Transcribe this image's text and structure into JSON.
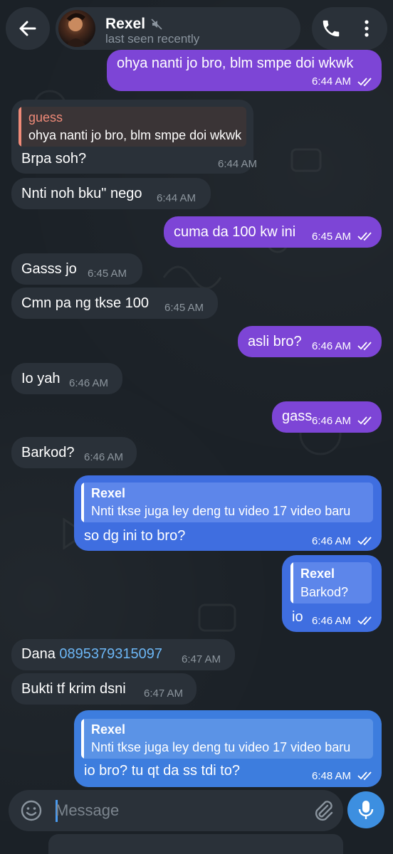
{
  "header": {
    "contact_name": "Rexel",
    "status": "last seen recently"
  },
  "messages": [
    {
      "dir": "out",
      "text": "ohya nanti jo bro, blm smpe doi wkwk",
      "time": "6:44 AM"
    },
    {
      "dir": "in",
      "reply_name": "guess",
      "reply_text": "ohya nanti jo bro, blm smpe doi wkwk",
      "text": "Brpa soh?",
      "time": "6:44 AM"
    },
    {
      "dir": "in",
      "text": "Nnti noh bku\" nego",
      "time": "6:44 AM"
    },
    {
      "dir": "out",
      "text": "cuma da 100 kw ini",
      "time": "6:45 AM"
    },
    {
      "dir": "in",
      "text": "Gasss jo",
      "time": "6:45 AM"
    },
    {
      "dir": "in",
      "text": "Cmn pa ng tkse 100",
      "time": "6:45 AM"
    },
    {
      "dir": "out",
      "text": "asli bro?",
      "time": "6:46 AM"
    },
    {
      "dir": "in",
      "text": "Io yah",
      "time": "6:46 AM"
    },
    {
      "dir": "out",
      "text": "gass",
      "time": "6:46 AM"
    },
    {
      "dir": "in",
      "text": "Barkod?",
      "time": "6:46 AM"
    },
    {
      "dir": "out",
      "reply_name": "Rexel",
      "reply_text": "Nnti tkse juga ley deng tu video 17 video baru",
      "text": "so dg ini to bro?",
      "time": "6:46 AM"
    },
    {
      "dir": "out",
      "reply_name": "Rexel",
      "reply_text": "Barkod?",
      "text": "io",
      "time": "6:46 AM"
    },
    {
      "dir": "in",
      "text": "Dana ",
      "link": "0895379315097",
      "time": "6:47 AM"
    },
    {
      "dir": "in",
      "text": "Bukti tf krim dsni",
      "time": "6:47 AM"
    },
    {
      "dir": "out",
      "reply_name": "Rexel",
      "reply_text": "Nnti tkse juga ley deng tu video 17 video baru",
      "text": "io bro? tu qt da ss tdi to?",
      "time": "6:48 AM"
    }
  ],
  "composer": {
    "placeholder": "Message"
  },
  "colors": {
    "background": "#1b2127",
    "incoming_bubble": "#2a3139",
    "outgoing_purple": "#7d45d6",
    "outgoing_blue": "#3f6ee0",
    "accent_blue": "#3d8fe0",
    "reply_name_incoming": "#ef8a78",
    "link": "#6cb6f5"
  },
  "icons": {
    "back": "arrow-left-icon",
    "mute": "speaker-muted-icon",
    "call": "phone-icon",
    "menu": "more-vertical-icon",
    "emoji": "smiley-icon",
    "attach": "paperclip-icon",
    "mic": "microphone-icon",
    "read": "double-check-icon"
  }
}
